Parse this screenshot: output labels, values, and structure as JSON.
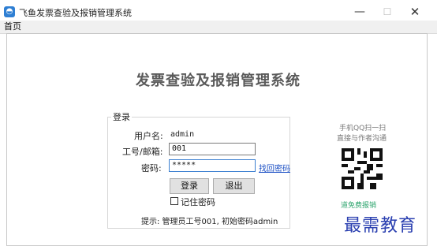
{
  "window": {
    "title": "飞鱼发票查验及报销管理系统",
    "min_glyph": "—",
    "max_glyph": "☐",
    "close_glyph": "✕"
  },
  "menu": {
    "items": [
      "首页"
    ]
  },
  "main": {
    "title": "发票查验及报销管理系统"
  },
  "login": {
    "group_title": "登录",
    "username_label": "用户名:",
    "username_value": "admin",
    "id_label": "工号/邮箱:",
    "id_value": "001",
    "password_label": "密码:",
    "password_value": "*****",
    "retrieve_link": "找回密码",
    "login_button": "登录",
    "exit_button": "退出",
    "remember_label": "记住密码",
    "hint": "提示: 管理员工号001, 初始密码admin"
  },
  "side": {
    "qq_line1": "手机QQ扫一扫",
    "qq_line2": "直接与作者沟通",
    "green_link": "免费报销"
  },
  "watermark": "最需教育"
}
